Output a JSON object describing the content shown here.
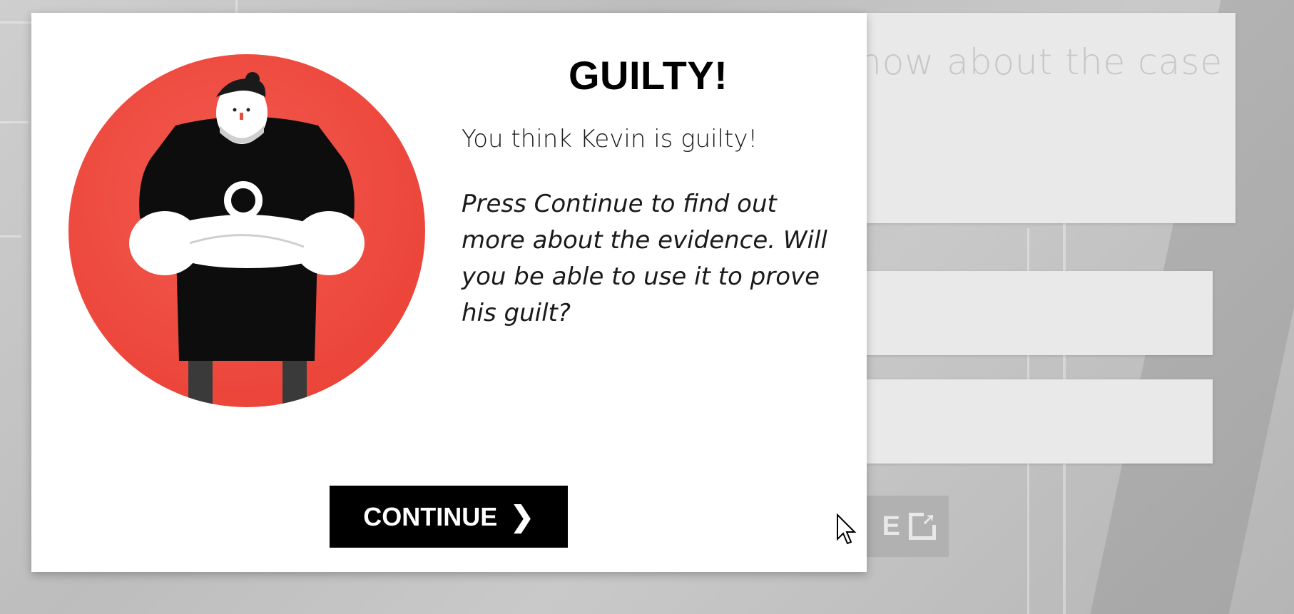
{
  "background": {
    "heading_fragment": "now about the case",
    "button_fragment": "E"
  },
  "modal": {
    "title": "GUILTY!",
    "lead": "You think Kevin is guilty!",
    "body": "Press Continue to find out more about the evidence. Will you be able to use it to prove his guilt?",
    "continue_label": "CONTINUE",
    "continue_icon": "chevron-right-icon",
    "accent_color": "#ee4a3f"
  }
}
